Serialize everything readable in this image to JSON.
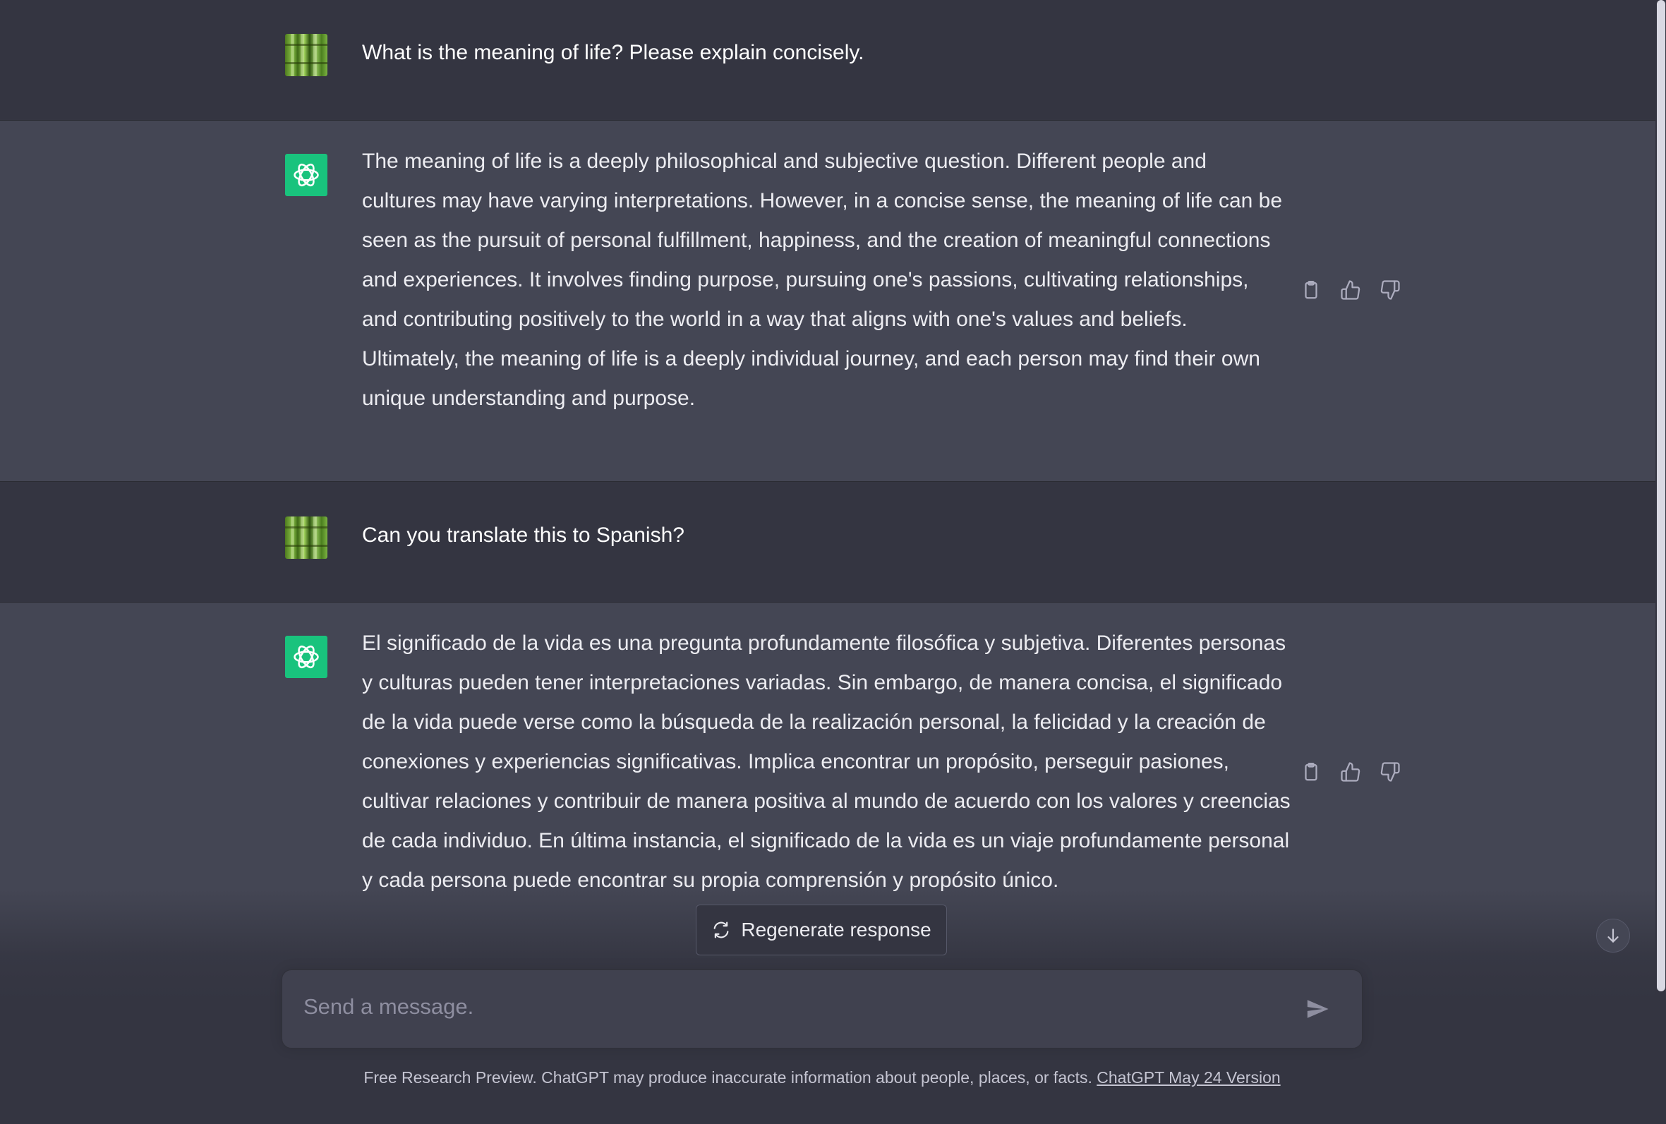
{
  "conversation": {
    "messages": [
      {
        "role": "user",
        "text": "What is the meaning of life? Please explain concisely."
      },
      {
        "role": "assistant",
        "text": "The meaning of life is a deeply philosophical and subjective question. Different people and cultures may have varying interpretations. However, in a concise sense, the meaning of life can be seen as the pursuit of personal fulfillment, happiness, and the creation of meaningful connections and experiences. It involves finding purpose, pursuing one's passions, cultivating relationships, and contributing positively to the world in a way that aligns with one's values and beliefs. Ultimately, the meaning of life is a deeply individual journey, and each person may find their own unique understanding and purpose."
      },
      {
        "role": "user",
        "text": "Can you translate this to Spanish?"
      },
      {
        "role": "assistant",
        "text": "El significado de la vida es una pregunta profundamente filosófica y subjetiva. Diferentes personas y culturas pueden tener interpretaciones variadas. Sin embargo, de manera concisa, el significado de la vida puede verse como la búsqueda de la realización personal, la felicidad y la creación de conexiones y experiencias significativas. Implica encontrar un propósito, perseguir pasiones, cultivar relaciones y contribuir de manera positiva al mundo de acuerdo con los valores y creencias de cada individuo. En última instancia, el significado de la vida es un viaje profundamente personal y cada persona puede encontrar su propia comprensión y propósito único."
      }
    ]
  },
  "actions": {
    "icons": [
      "clipboard-icon",
      "thumbs-up-icon",
      "thumbs-down-icon"
    ]
  },
  "regenerate": {
    "label": "Regenerate response",
    "icon": "refresh-icon"
  },
  "composer": {
    "placeholder": "Send a message.",
    "send_icon": "send-icon"
  },
  "footer": {
    "text": "Free Research Preview. ChatGPT may produce inaccurate information about people, places, or facts. ",
    "link_label": "ChatGPT May 24 Version"
  },
  "colors": {
    "background": "#343541",
    "assistant_row": "#444654",
    "brand_green": "#19c37d",
    "text": "#ececf1",
    "muted": "#8e8ea0"
  }
}
